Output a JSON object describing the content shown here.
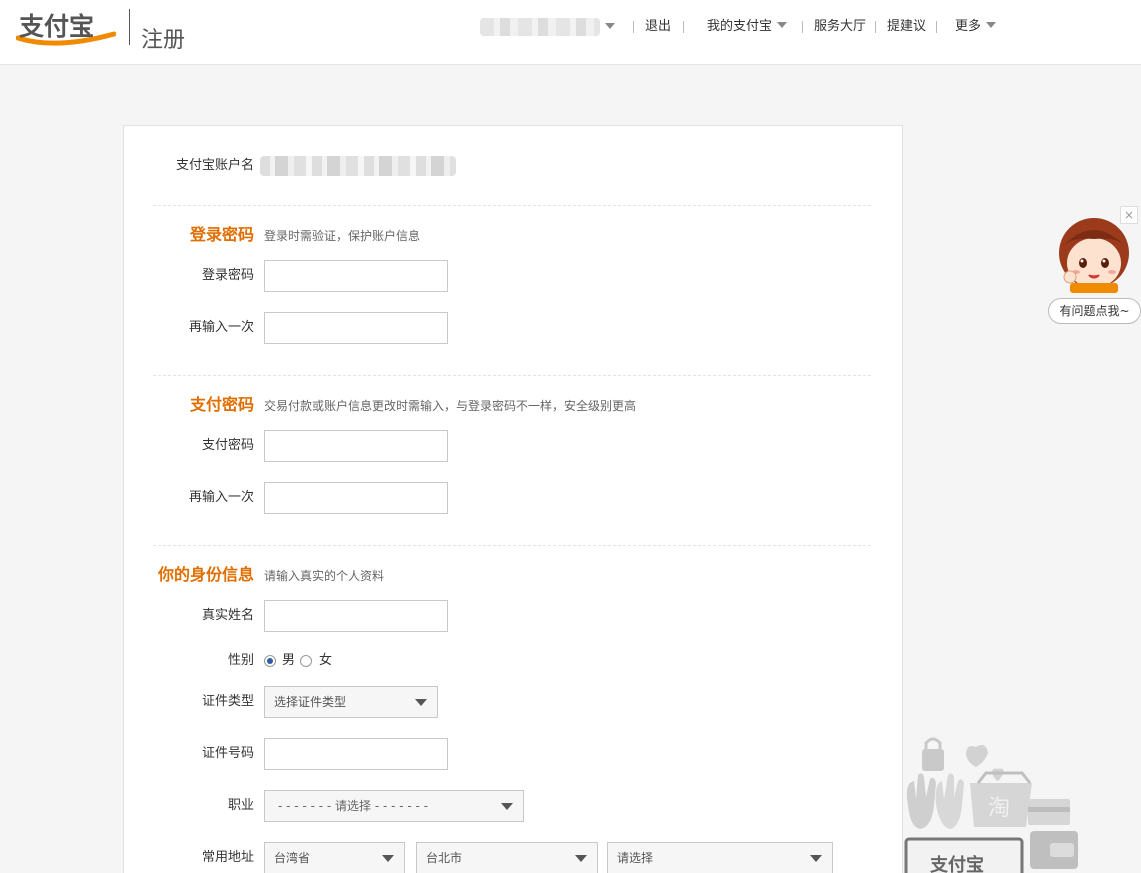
{
  "header": {
    "logo_text": "支付宝",
    "page_title": "注册",
    "nav": {
      "logout": "退出",
      "my_alipay": "我的支付宝",
      "service_hall": "服务大厅",
      "suggestion": "提建议",
      "more": "更多"
    }
  },
  "account": {
    "label": "支付宝账户名"
  },
  "login_section": {
    "title": "登录密码",
    "desc": "登录时需验证，保护账户信息",
    "password_label": "登录密码",
    "repeat_label": "再输入一次"
  },
  "pay_section": {
    "title": "支付密码",
    "desc": "交易付款或账户信息更改时需输入，与登录密码不一样，安全级别更高",
    "password_label": "支付密码",
    "repeat_label": "再输入一次"
  },
  "identity_section": {
    "title": "你的身份信息",
    "desc": "请输入真实的个人资料",
    "realname_label": "真实姓名",
    "gender_label": "性别",
    "gender_options": [
      "男",
      "女"
    ],
    "gender_selected": "男",
    "idtype_label": "证件类型",
    "idtype_value": "选择证件类型",
    "idnumber_label": "证件号码",
    "occupation_label": "职业",
    "occupation_value": "- - - - - - - 请选择 - - - - - - -",
    "address_label": "常用地址",
    "province_value": "台湾省",
    "city_value": "台北市",
    "district_value": "请选择"
  },
  "helper": {
    "bubble_text": "有问题点我~",
    "close_glyph": "×"
  },
  "deco": {
    "taobao_char": "淘",
    "logo_text": "支付宝"
  },
  "colors": {
    "accent": "#e06e00",
    "radio_selected": "#2c5ea8"
  }
}
